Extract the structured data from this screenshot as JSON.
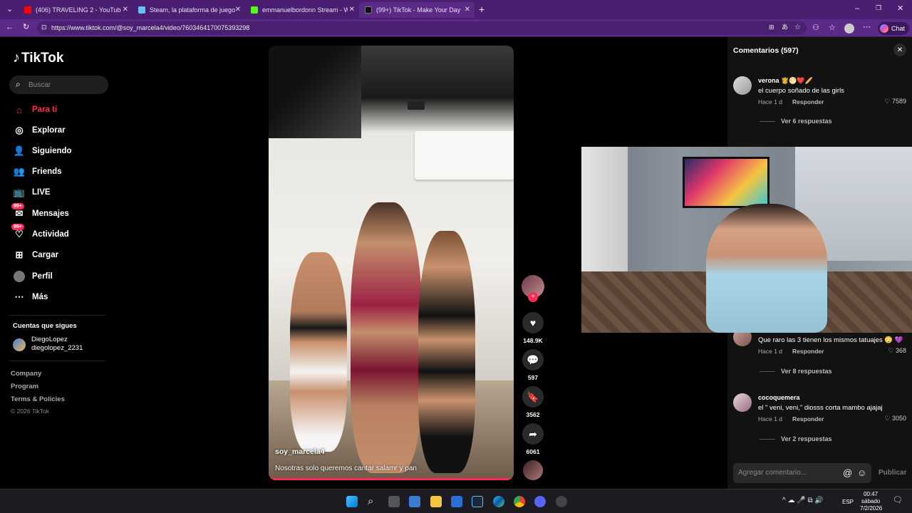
{
  "tabs": [
    {
      "title": "(406) TRAVELING 2 - YouTube",
      "color": "#ff0000"
    },
    {
      "title": "Steam, la plataforma de juegos c",
      "color": "#1b2838"
    },
    {
      "title": "emmanuelbordonn Stream - Watc",
      "color": "#53fc18"
    },
    {
      "title": "(99+) TikTok - Make Your Day",
      "color": "#111111"
    }
  ],
  "address": {
    "url": "https://www.tiktok.com/@soy_marcela4/video/7603464170075393298",
    "chat_label": "Chat"
  },
  "sidebar": {
    "logo": "TikTok",
    "search_placeholder": "Buscar",
    "nav": [
      {
        "label": "Para ti",
        "icon": "home-icon",
        "active": true
      },
      {
        "label": "Explorar",
        "icon": "compass-icon"
      },
      {
        "label": "Siguiendo",
        "icon": "following-icon"
      },
      {
        "label": "Friends",
        "icon": "friends-icon"
      },
      {
        "label": "LIVE",
        "icon": "live-icon"
      },
      {
        "label": "Mensajes",
        "icon": "messages-icon",
        "badge": "99+"
      },
      {
        "label": "Actividad",
        "icon": "activity-icon",
        "badge": "99+"
      },
      {
        "label": "Cargar",
        "icon": "upload-icon"
      },
      {
        "label": "Perfil",
        "icon": "profile-icon"
      },
      {
        "label": "Más",
        "icon": "more-icon"
      }
    ],
    "following_title": "Cuentas que sigues",
    "following_name": "DiegoLopez",
    "following_handle": "diegolopez_2231",
    "footer": [
      "Company",
      "Program",
      "Terms & Policies"
    ],
    "copyright": "© 2026 TikTok"
  },
  "video": {
    "author": "soy_marcela4",
    "caption": "Nosotras solo queremos cantar salamr y pan",
    "progress": 1.0
  },
  "actions": {
    "likes": "148.9K",
    "comments": "597",
    "saves": "3562",
    "shares": "6061"
  },
  "comments": {
    "title": "Comentarios (597)",
    "items": [
      {
        "name": "verona",
        "text": "el cuerpo soñado de las girls",
        "time": "Hace 1 d",
        "reply": "Responder",
        "likes": "7589",
        "more": "Ver 6 respuestas"
      },
      {
        "name": "",
        "text": "Que raro las 3 tienen los mismos tatuajes 😳 💜",
        "time": "Hace 1 d",
        "reply": "Responder",
        "likes": "368",
        "more": "Ver 8 respuestas"
      },
      {
        "name": "cocoquemera",
        "text": "el \" veni, veni,\" diosss corta mambo ajajaj",
        "time": "Hace 1 d",
        "reply": "Responder",
        "likes": "3050",
        "more": "Ver 2 respuestas"
      }
    ],
    "input_placeholder": "Agregar comentario...",
    "publish": "Publicar"
  },
  "taskbar": {
    "lang": "ESP",
    "time": "00:47",
    "day": "sábado",
    "date": "7/2/2026"
  }
}
